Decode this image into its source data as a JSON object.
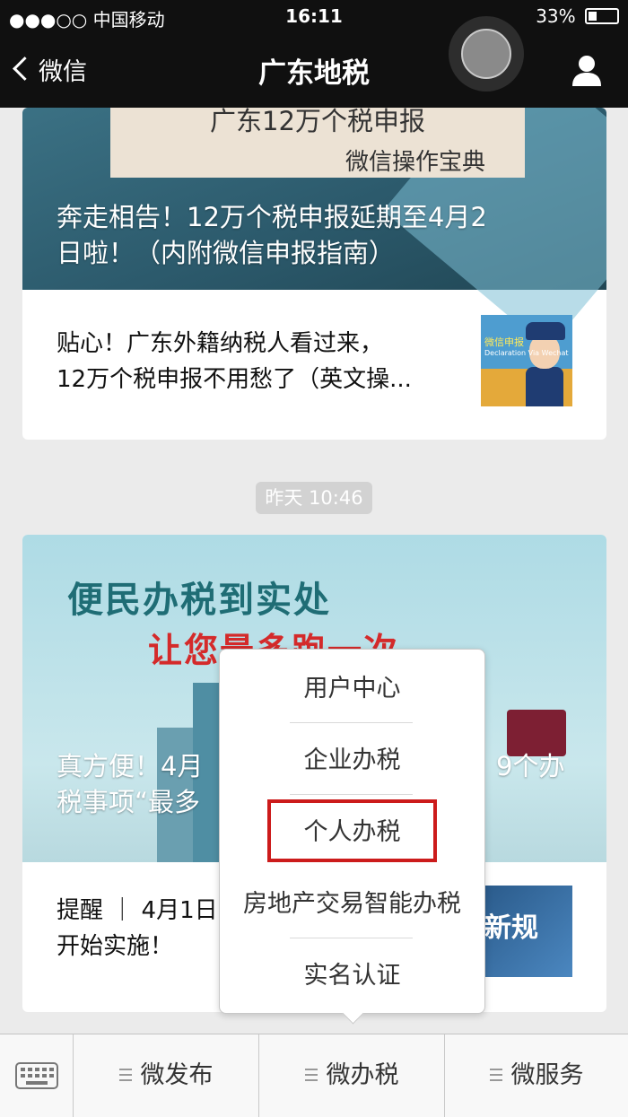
{
  "status_bar": {
    "carrier": "●●●○○ 中国移动",
    "time": "16:11",
    "battery": "33%"
  },
  "nav": {
    "back_label": "微信",
    "title": "广东地税"
  },
  "articles": [
    {
      "cover_text_top": "广东12万个税申报",
      "cover_text_sub": "微信操作宝典",
      "cover_title_lines": [
        "奔走相告！12万个税申报延期至4月2",
        "日啦！（内附微信申报指南）"
      ],
      "sub_lines": [
        "贴心！广东外籍纳税人看过来，",
        "12万个税申报不用愁了（英文操..."
      ],
      "thumb_label": "微信申报",
      "thumb_label2": "Declaration Via Wechat"
    },
    {
      "cover_head1": "便民办税到实处",
      "cover_head2": "让您最多跑一次",
      "cover_title_lines": [
        "真方便！4月",
        "税事项“最多"
      ],
      "cover_title_right": "9个办",
      "sub_lines": [
        "提醒 ｜ 4月1日",
        "开始实施！"
      ],
      "thumb_label": "新规"
    }
  ],
  "timestamp_divider": "昨天 10:46",
  "popup_menu": {
    "items": [
      "用户中心",
      "企业办税",
      "个人办税",
      "房地产交易智能办税",
      "实名认证"
    ],
    "highlighted_index": 2
  },
  "tabbar": {
    "tabs": [
      "微发布",
      "微办税",
      "微服务"
    ]
  },
  "colors": {
    "highlight_border": "#cc1b1b",
    "nav_background": "#101010"
  }
}
